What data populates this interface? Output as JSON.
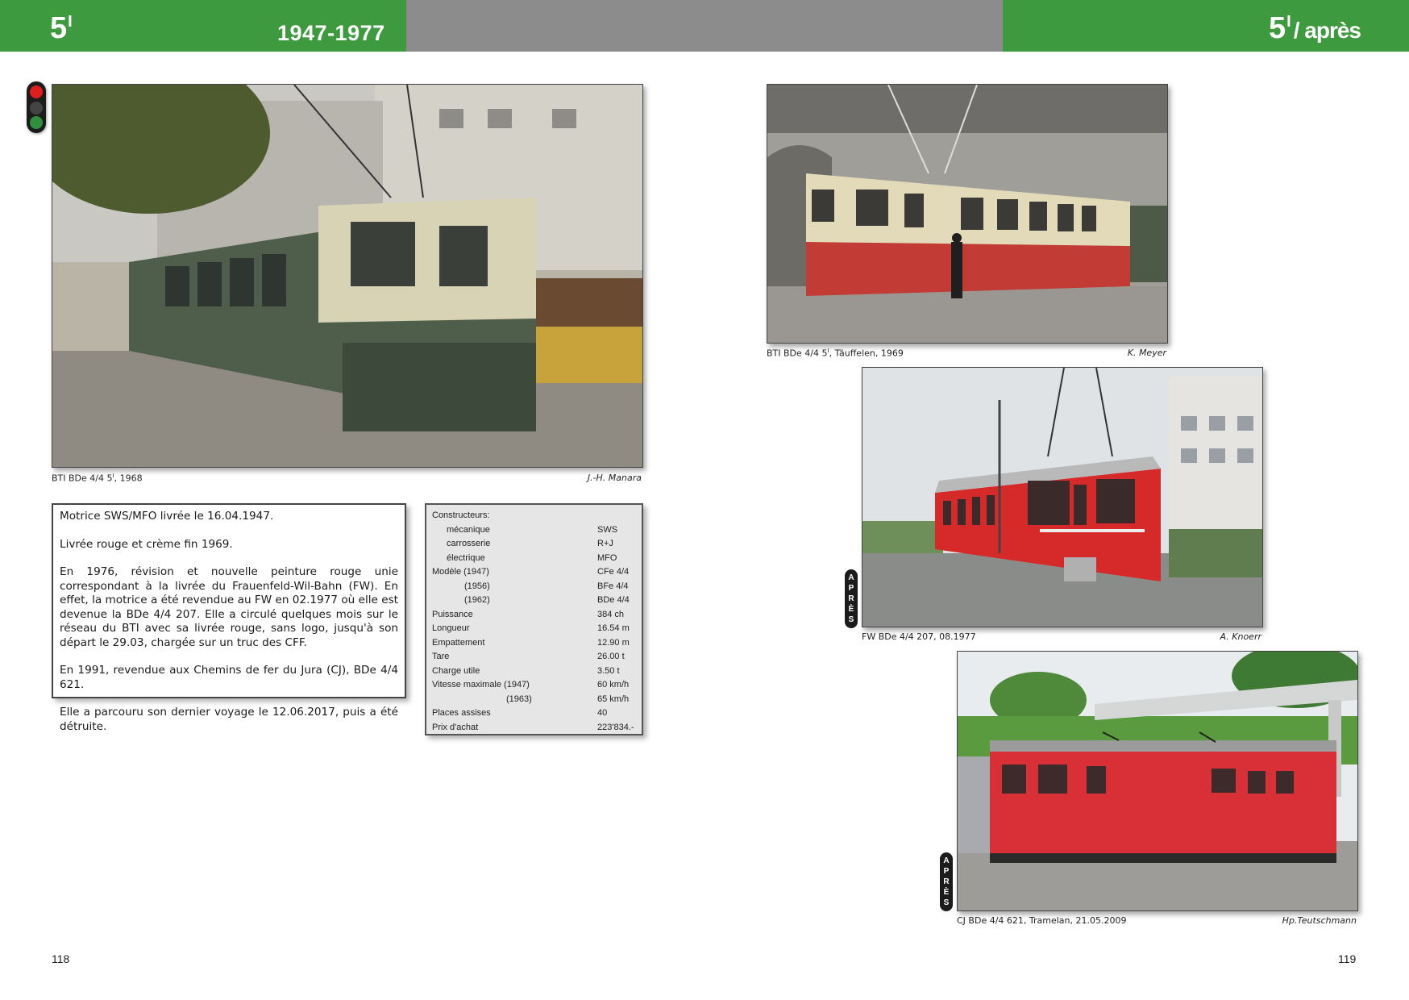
{
  "header": {
    "left_number": "5",
    "left_superscript": "I",
    "period": "1947-1977",
    "right_number": "5",
    "right_superscript": "I",
    "right_suffix": "/ après",
    "accent_color": "#3e9a3e",
    "center_color": "#8c8c8c"
  },
  "signal": {
    "icon": "traffic-signal-icon",
    "lamps": [
      "#e02020",
      "#3a3a3a",
      "#2f8f3f"
    ]
  },
  "photos": {
    "main": {
      "caption": "BTI BDe 4/4 5",
      "caption_sup": "I",
      "caption_year": ", 1968",
      "credit": "J.-H. Manara"
    },
    "top_right": {
      "caption": "BTI BDe 4/4 5",
      "caption_sup": "I",
      "caption_year": ", Täuffelen, 1969",
      "credit": "K. Meyer"
    },
    "middle_right": {
      "caption": "FW BDe 4/4 207, 08.1977",
      "credit": "A. Knoerr",
      "tag": [
        "A",
        "P",
        "R",
        "È",
        "S"
      ]
    },
    "bottom_right": {
      "caption": "CJ BDe 4/4 621, Tramelan, 21.05.2009",
      "credit": "Hp.Teutschmann",
      "tag": [
        "A",
        "P",
        "R",
        "È",
        "S"
      ]
    }
  },
  "history": {
    "p1": "Motrice SWS/MFO livrée le 16.04.1947.",
    "p2": "Livrée rouge et crème fin 1969.",
    "p3": "En 1976, révision et nouvelle peinture rouge unie correspondant à la livrée du Frauenfeld-Wil-Bahn (FW). En effet, la motrice a été revendue au FW en 02.1977 où elle est devenue la BDe 4/4 207. Elle a circulé quelques mois sur le réseau du BTI avec sa livrée rouge, sans logo, jusqu'à son départ le 29.03, chargée sur un truc des CFF.",
    "p4": "En 1991, revendue aux Chemins de fer du Jura (CJ), BDe 4/4 621.",
    "p5": "Elle a parcouru son dernier voyage le 12.06.2017, puis a été détruite."
  },
  "specs": [
    {
      "label": "Constructeurs:",
      "value": "",
      "indent": 0
    },
    {
      "label": "mécanique",
      "value": "SWS",
      "indent": 1
    },
    {
      "label": "carrosserie",
      "value": "R+J",
      "indent": 1
    },
    {
      "label": "électrique",
      "value": "MFO",
      "indent": 1
    },
    {
      "label": "Modèle (1947)",
      "value": "CFe 4/4",
      "indent": 0
    },
    {
      "label": "(1956)",
      "value": "BFe 4/4",
      "indent": 2
    },
    {
      "label": "(1962)",
      "value": "BDe 4/4",
      "indent": 2
    },
    {
      "label": "Puissance",
      "value": "384 ch",
      "indent": 0
    },
    {
      "label": "Longueur",
      "value": "16.54 m",
      "indent": 0
    },
    {
      "label": "Empattement",
      "value": "12.90 m",
      "indent": 0
    },
    {
      "label": "Tare",
      "value": "26.00 t",
      "indent": 0
    },
    {
      "label": "Charge utile",
      "value": "3.50 t",
      "indent": 0
    },
    {
      "label": "Vitesse maximale (1947)",
      "value": "60 km/h",
      "indent": 0
    },
    {
      "label": "(1963)",
      "value": "65 km/h",
      "indent": 3
    },
    {
      "label": "Places assises",
      "value": "40",
      "indent": 0
    },
    {
      "label": "Prix d'achat",
      "value": "223'834.-",
      "indent": 0
    }
  ],
  "pages": {
    "left": "118",
    "right": "119"
  }
}
